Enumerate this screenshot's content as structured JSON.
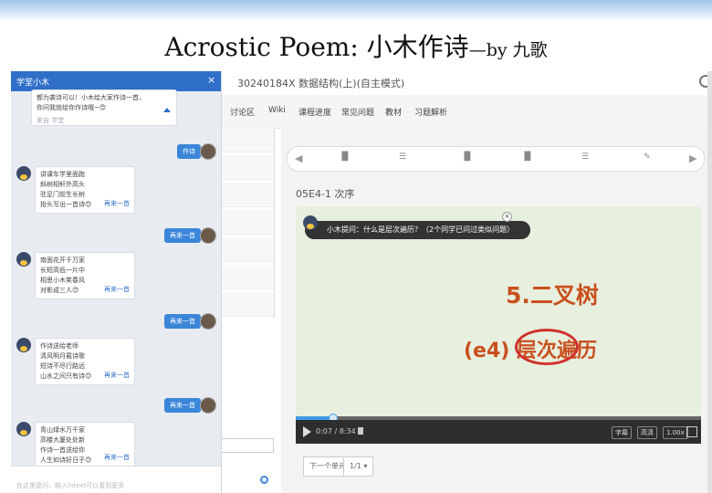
{
  "slide": {
    "title": "Acrostic Poem: 小木作诗",
    "byline": "—by 九歌"
  },
  "course": {
    "title": "30240184X 数据结构(上)(自主模式)"
  },
  "nav": {
    "tabs": [
      "讨论区",
      "Wiki",
      "课程进度",
      "常见问题",
      "教材",
      "习题解析"
    ]
  },
  "player": {
    "section": "05E4-1 次序",
    "question": "小木提问：什么是层次遍历？（2个同学已问过类似问题）",
    "heading": "5.二叉树",
    "topic": "(e4) 层次遍历",
    "time": "0:07 / 8:34",
    "buttons": [
      "字幕",
      "高清",
      "1.00x"
    ],
    "next_label": "下一个单元",
    "page_select": "1/1 ▾",
    "progress": 0.09
  },
  "chat": {
    "title": "学堂小木",
    "close": "×",
    "intro_lines": [
      "都为袭诗可以！小木给大家作诗一首，",
      "你问我就给你作诗哦~😊"
    ],
    "intro_foot": "来自 学堂",
    "user_messages": [
      "作诗",
      "再来一首",
      "再来一首",
      "再来一首"
    ],
    "poems": [
      {
        "lines": [
          "讲课车学里面跑",
          "斜树相轩外高头",
          "驻足门前生长树",
          "抬头写出一首诗😊"
        ],
        "more": "再来一首"
      },
      {
        "lines": [
          "南面花开千万家",
          "长短高低一片中",
          "相思小木笑春风",
          "对影成三人😊"
        ],
        "more": "再来一首"
      },
      {
        "lines": [
          "作诗送给老师",
          "清风明月载诗歌",
          "短诗不尽行路远",
          "山水之间只有诗😊"
        ],
        "more": "再来一首"
      },
      {
        "lines": [
          "青山绿水万千家",
          "高楼大厦处处新",
          "作诗一首送给你",
          "人生如诗好日子😊"
        ],
        "more": "再来一首"
      }
    ],
    "hint": "在这里提问，输入intext可以看到更多"
  }
}
